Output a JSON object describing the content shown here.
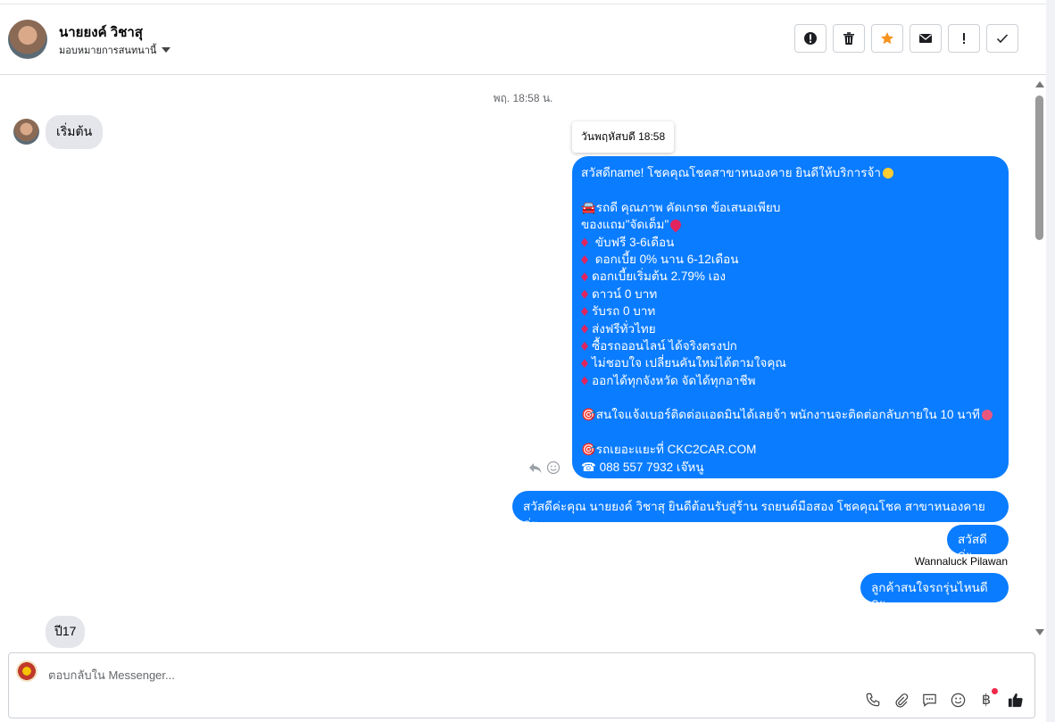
{
  "header": {
    "contact_name": "นายยงค์ วิชาสุ",
    "assign_label": "มอบหมายการสนทนานี้",
    "actions": [
      {
        "name": "report-button",
        "label": "!"
      },
      {
        "name": "delete-button",
        "label": ""
      },
      {
        "name": "star-button",
        "label": ""
      },
      {
        "name": "mark-unread-button",
        "label": ""
      },
      {
        "name": "follow-up-button",
        "label": "!"
      },
      {
        "name": "mark-done-button",
        "label": ""
      }
    ]
  },
  "chat": {
    "date_separator": "พฤ. 18:58 น.",
    "incoming_start": "เริ่มต้น",
    "tooltip": "วันพฤหัสบดี 18:58",
    "promo_lines": [
      {
        "k": "text",
        "t": "สวัสดีname! โชคคุณโชคสาขาหนองคาย ยินดีให้บริการจ้า"
      },
      {
        "k": "blank",
        "t": ""
      },
      {
        "k": "text",
        "t": "🚘รถดี คุณภาพ คัดเกรด ข้อเสนอเพียบ"
      },
      {
        "k": "text",
        "t": "ของแถม\"จัดเต็ม\""
      },
      {
        "k": "dia",
        "t": " ขับฟรี 3-6เดือน"
      },
      {
        "k": "dia",
        "t": " ดอกเบี้ย 0% นาน 6-12เดือน"
      },
      {
        "k": "dia",
        "t": "ดอกเบี้ยเริ่มต้น 2.79% เอง"
      },
      {
        "k": "dia",
        "t": "ดาวน์ 0 บาท"
      },
      {
        "k": "dia",
        "t": "รับรถ 0 บาท"
      },
      {
        "k": "dia",
        "t": "ส่งฟรีทั่วไทย"
      },
      {
        "k": "dia",
        "t": "ซื้อรถออนไลน์ ได้จริงตรงปก"
      },
      {
        "k": "dia",
        "t": "ไม่ชอบใจ เปลี่ยนคันใหม่ได้ตามใจคุณ"
      },
      {
        "k": "dia",
        "t": "ออกได้ทุกจังหวัด จัดได้ทุกอาชีพ"
      },
      {
        "k": "blank",
        "t": ""
      },
      {
        "k": "text",
        "t": "🎯สนใจแจ้งเบอร์ติดต่อแอดมินได้เลยจ้า พนักงานจะติดต่อกลับภายใน 10 นาที"
      },
      {
        "k": "blank",
        "t": ""
      },
      {
        "k": "text",
        "t": "🎯รถเยอะแยะที่ CKC2CAR.COM"
      },
      {
        "k": "text",
        "t": "☎ 088 557 7932 เจ๊หนู"
      }
    ],
    "welcome": "สวัสดีค่ะคุณ นายยงค์ วิชาสุ ยินดีต้อนรับสู่ร้าน รถยนต์มือสอง โชคคุณโชค สาขาหนองคาย ค่ะ",
    "hello": "สวัสดีค่ะ",
    "sender": "Wannaluck Pilawan",
    "question": "ลูกค้าสนใจรถรุ่นไหนดีคะ",
    "incoming_reply": "ปี17"
  },
  "composer": {
    "placeholder": "ตอบกลับใน Messenger...",
    "baht_symbol": "฿"
  },
  "colors": {
    "outgoing_bubble": "#0a7cff",
    "incoming_bubble": "#e4e6eb",
    "star": "#f7931e"
  }
}
